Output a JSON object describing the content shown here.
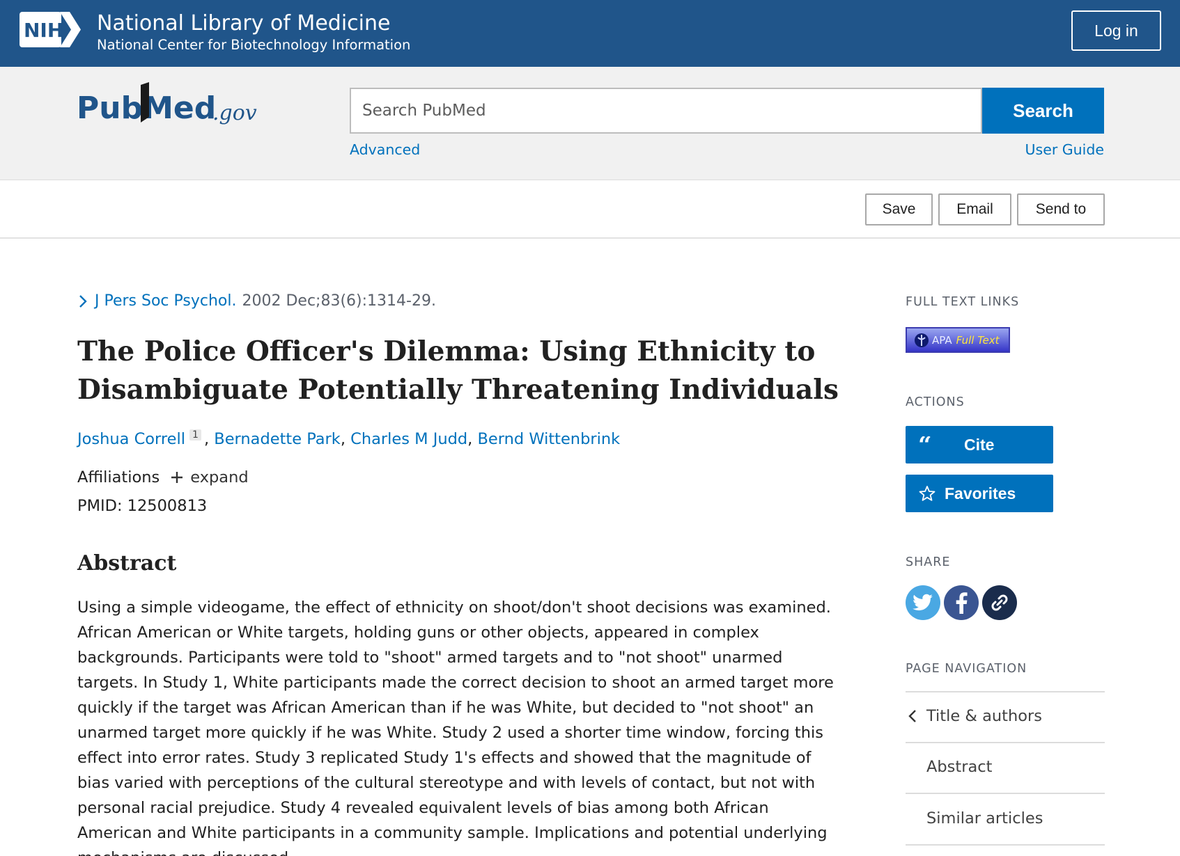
{
  "nih": {
    "logo_text": "NIH",
    "title": "National Library of Medicine",
    "subtitle": "National Center for Biotechnology Information",
    "login_label": "Log in"
  },
  "search": {
    "logo_text": "PubMed",
    "logo_suffix": ".gov",
    "placeholder": "Search PubMed",
    "value": "",
    "button_label": "Search",
    "advanced_label": "Advanced",
    "guide_label": "User Guide"
  },
  "actions": {
    "save_label": "Save",
    "email_label": "Email",
    "send_label": "Send to"
  },
  "article": {
    "journal": "J Pers Soc Psychol.",
    "citation": "2002 Dec;83(6):1314-29.",
    "title": "The Police Officer's Dilemma: Using Ethnicity to Disambiguate Potentially Threatening Individuals",
    "authors": [
      "Joshua Correll",
      "Bernadette Park",
      "Charles M Judd",
      "Bernd Wittenbrink"
    ],
    "affiliation_marker": "1",
    "affiliations_label": "Affiliations",
    "expand_label": "expand",
    "pmid_label": "PMID: 12500813",
    "abstract_heading": "Abstract",
    "abstract_text": "Using a simple videogame, the effect of ethnicity on shoot/don't shoot decisions was examined. African American or White targets, holding guns or other objects, appeared in complex backgrounds. Participants were told to \"shoot\" armed targets and to \"not shoot\" unarmed targets. In Study 1, White participants made the correct decision to shoot an armed target more quickly if the target was African American than if he was White, but decided to \"not shoot\" an unarmed target more quickly if he was White. Study 2 used a shorter time window, forcing this effect into error rates. Study 3 replicated Study 1's effects and showed that the magnitude of bias varied with perceptions of the cultural stereotype and with levels of contact, but not with personal racial prejudice. Study 4 revealed equivalent levels of bias among both African American and White participants in a community sample. Implications and potential underlying mechanisms are discussed."
  },
  "sidebar": {
    "full_text_heading": "FULL TEXT LINKS",
    "apa_text": "APA",
    "apa_full_text": "Full Text",
    "actions_heading": "ACTIONS",
    "cite_label": "Cite",
    "favorites_label": "Favorites",
    "share_heading": "SHARE",
    "page_nav_heading": "PAGE NAVIGATION",
    "page_nav": [
      "Title & authors",
      "Abstract",
      "Similar articles"
    ]
  },
  "colors": {
    "nih_blue": "#20558a",
    "accent": "#0071bc",
    "twitter": "#4aa8e3",
    "facebook": "#3a5592",
    "link_share": "#1a2c4c"
  }
}
